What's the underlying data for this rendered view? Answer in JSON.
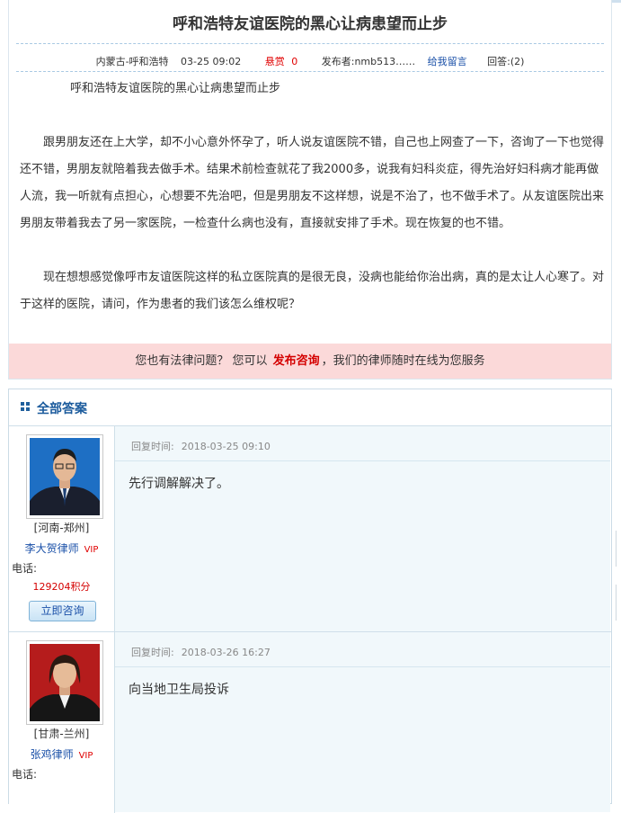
{
  "question": {
    "title": "呼和浩特友谊医院的黑心让病患望而止步",
    "meta": {
      "location": "内蒙古-呼和浩特",
      "date": "03-25 09:02",
      "bounty_label": "悬赏",
      "bounty_value": "0",
      "poster_label": "发布者:",
      "poster": "nmb513……",
      "leave_message": "给我留言",
      "answers_label": "回答:",
      "answers_count": "(2)"
    },
    "paragraphs": [
      "呼和浩特友谊医院的黑心让病患望而止步",
      "跟男朋友还在上大学，却不小心意外怀孕了，听人说友谊医院不错，自己也上网查了一下，咨询了一下也觉得还不错，男朋友就陪着我去做手术。结果术前检查就花了我2000多，说我有妇科炎症，得先治好妇科病才能再做人流，我一听就有点担心，心想要不先治吧，但是男朋友不这样想，说是不治了，也不做手术了。从友谊医院出来男朋友带着我去了另一家医院，一检查什么病也没有，直接就安排了手术。现在恢复的也不错。",
      "现在想想感觉像呼市友谊医院这样的私立医院真的是很无良，没病也能给你治出病，真的是太让人心寒了。对于这样的医院，请问，作为患者的我们该怎么维权呢？"
    ]
  },
  "promo": {
    "before": "您也有法律问题？ 您可以",
    "link": "发布咨询",
    "after": "，我们的律师随时在线为您服务"
  },
  "answers": {
    "header": "全部答案",
    "items": [
      {
        "reply_label": "回复时间:",
        "reply_time": "2018-03-25 09:10",
        "content": "先行调解解决了。",
        "lawyer": {
          "location": "[河南-郑州]",
          "name": "李大贺律师",
          "vip": "VIP",
          "phone_label": "电话:",
          "points": "129204积分",
          "consult_button": "立即咨询"
        }
      },
      {
        "reply_label": "回复时间:",
        "reply_time": "2018-03-26 16:27",
        "content": "向当地卫生局投诉",
        "lawyer": {
          "location": "[甘肃-兰州]",
          "name": "张鸡律师",
          "vip": "VIP",
          "phone_label": "电话:"
        }
      }
    ]
  },
  "colors": {
    "link_blue": "#1a50a8",
    "accent_red": "#d40000",
    "promo_bg": "#fbd9d9",
    "panel_bg": "#f1f8fb"
  }
}
